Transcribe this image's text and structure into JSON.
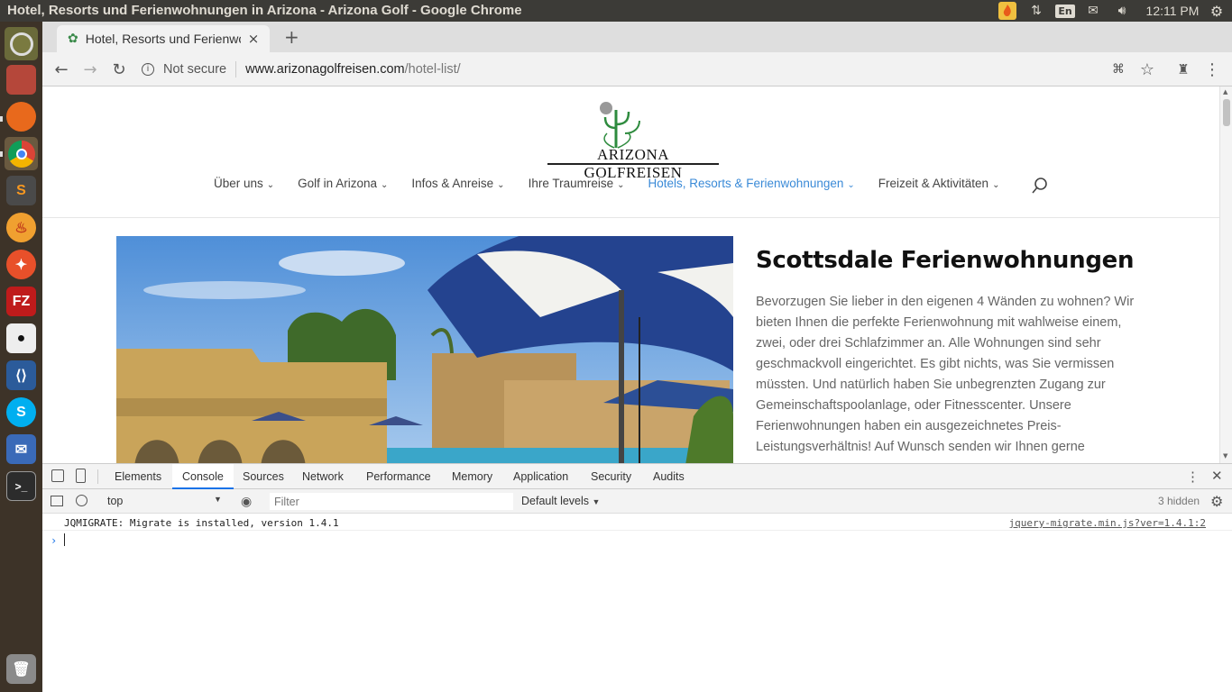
{
  "system": {
    "window_title": "Hotel, Resorts und Ferienwohnungen in Arizona - Arizona Golf - Google Chrome",
    "keyboard_layout": "En",
    "clock": "12:11 PM"
  },
  "browser": {
    "tab_title": "Hotel, Resorts und Ferienwohnungen in Arizona",
    "tab_close": "×",
    "new_tab": "+",
    "security_label": "Not secure",
    "url_host": "www.arizonagolfreisen.com",
    "url_path": "/hotel-list/"
  },
  "site": {
    "logo_text": "ARIZONA GOLFREISEN",
    "nav": [
      {
        "label": "Über uns"
      },
      {
        "label": "Golf in Arizona"
      },
      {
        "label": "Infos & Anreise"
      },
      {
        "label": "Ihre Traumreise"
      },
      {
        "label": "Hotels, Resorts & Ferienwohnungen",
        "active": true
      },
      {
        "label": "Freizeit & Aktivitäten"
      }
    ],
    "article_title": "Scottsdale Ferienwohnungen",
    "article_body": "Bevorzugen Sie lieber in den eigenen 4 Wänden zu wohnen? Wir bieten Ihnen die perfekte Ferienwohnung mit wahlweise einem, zwei, oder drei Schlafzimmer an. Alle Wohnungen sind sehr geschmackvoll eingerichtet. Es gibt nichts, was Sie vermissen müssten. Und natürlich haben Sie unbegrenzten Zugang zur Gemeinschaftspoolanlage, oder Fitnesscenter. Unsere Ferienwohnungen haben ein ausgezeichnetes Preis-Leistungsverhältnis! Auf Wunsch senden wir Ihnen gerne"
  },
  "devtools": {
    "tabs": [
      "Elements",
      "Console",
      "Sources",
      "Network",
      "Performance",
      "Memory",
      "Application",
      "Security",
      "Audits"
    ],
    "active_tab": "Console",
    "context": "top",
    "filter_placeholder": "Filter",
    "levels": "Default levels",
    "hidden": "3 hidden",
    "messages": [
      {
        "text": "JQMIGRATE: Migrate is installed, version 1.4.1",
        "source": "jquery-migrate.min.js?ver=1.4.1:2"
      }
    ],
    "prompt": "›"
  },
  "colors": {
    "nav_active": "#3a8ad7",
    "devtools_accent": "#1a73e8",
    "launcher_bg": "#3d3328"
  }
}
